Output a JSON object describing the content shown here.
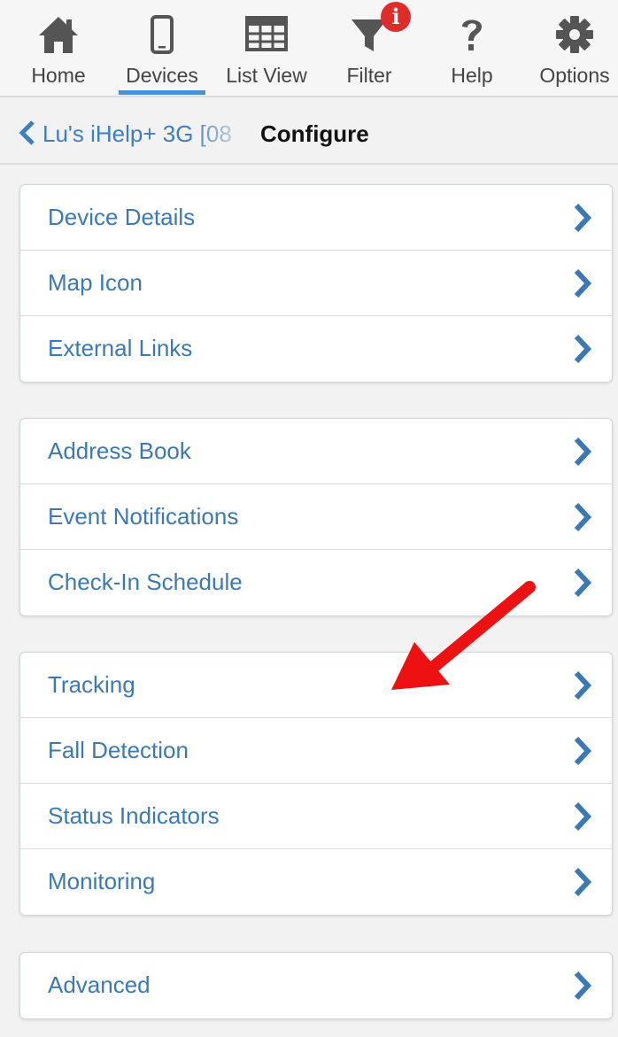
{
  "toolbar": {
    "items": [
      {
        "label": "Home",
        "icon": "home-icon"
      },
      {
        "label": "Devices",
        "icon": "phone-icon",
        "active": true
      },
      {
        "label": "List View",
        "icon": "grid-icon"
      },
      {
        "label": "Filter",
        "icon": "filter-icon",
        "badge": "i"
      },
      {
        "label": "Help",
        "icon": "question-icon"
      },
      {
        "label": "Options",
        "icon": "gear-icon"
      }
    ]
  },
  "breadcrumb": {
    "back_label": "Lu's iHelp+ 3G [08",
    "title": "Configure"
  },
  "groups": [
    {
      "items": [
        {
          "label": "Device Details"
        },
        {
          "label": "Map Icon"
        },
        {
          "label": "External Links"
        }
      ]
    },
    {
      "items": [
        {
          "label": "Address Book"
        },
        {
          "label": "Event Notifications"
        },
        {
          "label": "Check-In Schedule"
        }
      ]
    },
    {
      "items": [
        {
          "label": "Tracking"
        },
        {
          "label": "Fall Detection"
        },
        {
          "label": "Status Indicators"
        },
        {
          "label": "Monitoring"
        }
      ]
    },
    {
      "items": [
        {
          "label": "Advanced"
        }
      ]
    }
  ],
  "colors": {
    "accent": "#4a90d9",
    "link": "#3a79b8",
    "badge": "#e02b2b",
    "annotation_arrow": "#ee1111"
  }
}
